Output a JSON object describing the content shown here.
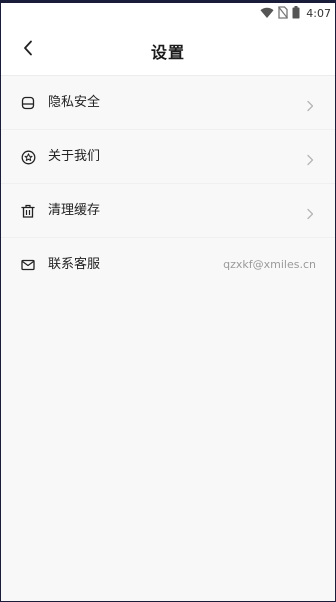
{
  "status_bar": {
    "time": "4:07",
    "icons": [
      "wifi-icon",
      "no-sim-icon",
      "battery-icon"
    ]
  },
  "header": {
    "back_icon": "back-arrow-icon",
    "title": "设置"
  },
  "menu": {
    "items": [
      {
        "icon": "privacy-icon",
        "label": "隐私安全",
        "has_chevron": true
      },
      {
        "icon": "about-icon",
        "label": "关于我们",
        "has_chevron": true
      },
      {
        "icon": "trash-icon",
        "label": "清理缓存",
        "has_chevron": true
      },
      {
        "icon": "mail-icon",
        "label": "联系客服",
        "value": "qzxkf@xmiles.cn"
      }
    ]
  },
  "colors": {
    "background": "#f8f8f8",
    "header_bg": "#ffffff",
    "text_primary": "#222222",
    "text_secondary": "#9a9a9a",
    "chevron": "#b5b5b5"
  }
}
